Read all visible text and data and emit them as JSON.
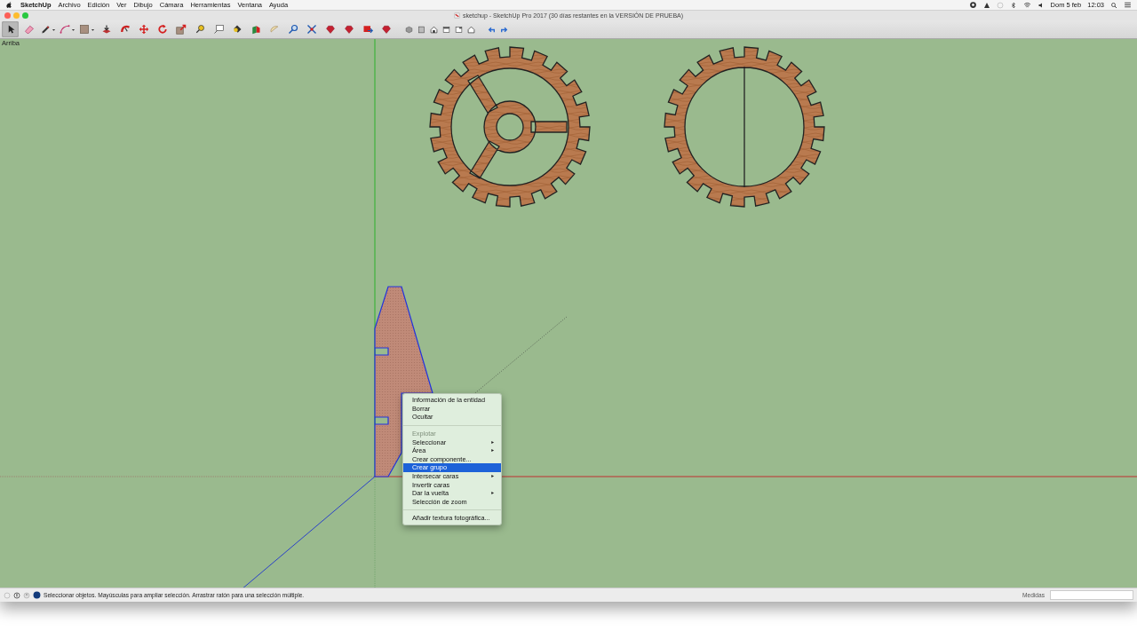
{
  "menu_bar": {
    "app": "SketchUp",
    "items": [
      "Archivo",
      "Edición",
      "Ver",
      "Dibujo",
      "Cámara",
      "Herramientas",
      "Ventana",
      "Ayuda"
    ],
    "date": "Dom 5 feb",
    "time": "12:03"
  },
  "window": {
    "title": "sketchup - SketchUp Pro 2017 (30 días restantes en la VERSIÓN DE PRUEBA)"
  },
  "toolbar": {
    "tools": [
      {
        "kind": "select",
        "selected": true
      },
      {
        "kind": "eraser",
        "selected": false
      },
      {
        "kind": "pencil",
        "selected": false,
        "dropdown": true
      },
      {
        "kind": "arc",
        "selected": false,
        "dropdown": true
      },
      {
        "kind": "rectangle",
        "selected": false,
        "dropdown": true
      },
      {
        "kind": "pushpull",
        "selected": false
      },
      {
        "kind": "followme",
        "selected": false
      },
      {
        "kind": "move",
        "selected": false
      },
      {
        "kind": "rotate",
        "selected": false
      },
      {
        "kind": "scale",
        "selected": false
      },
      {
        "kind": "tape",
        "selected": false
      },
      {
        "kind": "text",
        "selected": false
      },
      {
        "kind": "paint",
        "selected": false
      },
      {
        "kind": "section",
        "selected": false
      },
      {
        "kind": "orbit",
        "selected": false
      },
      {
        "kind": "zoom",
        "selected": false
      },
      {
        "kind": "extents",
        "selected": false
      },
      {
        "kind": "gem",
        "selected": false
      },
      {
        "kind": "gem",
        "selected": false
      },
      {
        "kind": "send",
        "selected": false
      },
      {
        "kind": "gem",
        "selected": false
      }
    ],
    "views": [
      {
        "kind": "iso"
      },
      {
        "kind": "top"
      },
      {
        "kind": "house"
      },
      {
        "kind": "front"
      },
      {
        "kind": "right"
      },
      {
        "kind": "outline"
      }
    ],
    "history": [
      {
        "kind": "undo"
      },
      {
        "kind": "redo"
      }
    ]
  },
  "viewport": {
    "view_label": "Arriba"
  },
  "context_menu": {
    "items": [
      {
        "kind": "item",
        "label": "Información de la entidad",
        "disabled": false,
        "submenu": false,
        "selected": false
      },
      {
        "kind": "item",
        "label": "Borrar",
        "disabled": false,
        "submenu": false,
        "selected": false
      },
      {
        "kind": "item",
        "label": "Ocultar",
        "disabled": false,
        "submenu": false,
        "selected": false
      },
      {
        "kind": "separator"
      },
      {
        "kind": "item",
        "label": "Explotar",
        "disabled": true,
        "submenu": false,
        "selected": false
      },
      {
        "kind": "item",
        "label": "Seleccionar",
        "disabled": false,
        "submenu": true,
        "selected": false
      },
      {
        "kind": "item",
        "label": "Área",
        "disabled": false,
        "submenu": true,
        "selected": false
      },
      {
        "kind": "item",
        "label": "Crear componente...",
        "disabled": false,
        "submenu": false,
        "selected": false
      },
      {
        "kind": "item",
        "label": "Crear grupo",
        "disabled": false,
        "submenu": false,
        "selected": true
      },
      {
        "kind": "item",
        "label": "Intersecar caras",
        "disabled": false,
        "submenu": true,
        "selected": false
      },
      {
        "kind": "item",
        "label": "Invertir caras",
        "disabled": false,
        "submenu": false,
        "selected": false
      },
      {
        "kind": "item",
        "label": "Dar la vuelta",
        "disabled": false,
        "submenu": true,
        "selected": false
      },
      {
        "kind": "item",
        "label": "Selección de zoom",
        "disabled": false,
        "submenu": false,
        "selected": false
      },
      {
        "kind": "separator"
      },
      {
        "kind": "item",
        "label": "Añadir textura fotográfica...",
        "disabled": false,
        "submenu": false,
        "selected": false
      }
    ]
  },
  "status_bar": {
    "hint": "Seleccionar objetos. Mayúsculas para ampliar selección. Arrastrar ratón para una selección múltiple.",
    "measurements_label": "Medidas"
  }
}
